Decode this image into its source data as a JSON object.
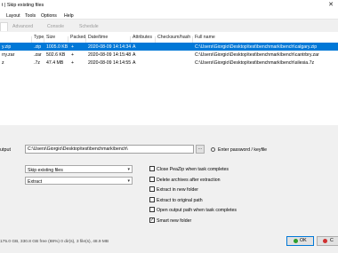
{
  "window": {
    "title": "t | Skip existing files",
    "close_glyph": "✕"
  },
  "menu": [
    "Layout",
    "Tools",
    "Options",
    "Help"
  ],
  "tabs": [
    {
      "label": "",
      "active": true
    },
    {
      "label": "Advanced",
      "active": false
    },
    {
      "label": "Console",
      "active": false
    },
    {
      "label": "Schedule",
      "active": false
    }
  ],
  "filelist": {
    "columns": [
      "Type",
      "Size",
      "Packed",
      "Date/time",
      "Attributes",
      "Checksum/hash",
      "Full name"
    ],
    "rows": [
      {
        "name": "y.zip",
        "type": ".zip",
        "size": "1005.0 KB",
        "packed": "+",
        "datetime": "2020-08-09 14:14:34",
        "attributes": "A",
        "checksum": "",
        "fullname": "C:\\Users\\Giorgio\\Desktop\\test\\benchmark\\bench\\calgary.zip",
        "selected": true
      },
      {
        "name": "rry.zar",
        "type": ".zar",
        "size": "502.6 KB",
        "packed": "+",
        "datetime": "2020-08-09 14:15:48",
        "attributes": "A",
        "checksum": "",
        "fullname": "C:\\Users\\Giorgio\\Desktop\\test\\benchmark\\bench\\cantrbry.zar",
        "selected": false
      },
      {
        "name": "z",
        "type": ".7z",
        "size": "47.4 MB",
        "packed": "+",
        "datetime": "2020-08-09 14:14:55",
        "attributes": "A",
        "checksum": "",
        "fullname": "C:\\Users\\Giorgio\\Desktop\\test\\benchmark\\bench\\silesia.7z",
        "selected": false
      }
    ]
  },
  "output": {
    "label": "utput",
    "path": "C:\\Users\\Giorgio\\Desktop\\test\\benchmark\\bench\\",
    "browse_label": "...",
    "password_label": "Enter password / keyfile"
  },
  "combos": [
    {
      "value": "Skip existing files"
    },
    {
      "value": "Extract"
    }
  ],
  "options": [
    {
      "label": "Close PeaZip when task completes",
      "checked": false
    },
    {
      "label": "Delete archives after extraction",
      "checked": false
    },
    {
      "label": "Extract in new folder",
      "checked": false
    },
    {
      "label": "Extract to original path",
      "checked": false
    },
    {
      "label": "Open output path when task completes",
      "checked": false
    },
    {
      "label": "Smart new folder",
      "checked": true
    }
  ],
  "status": "175.0 GB, 330.8 GB free (88%)     0 dir(s), 3 file(s), 48.9 MB",
  "buttons": {
    "ok": "OK",
    "cancel": "C"
  }
}
